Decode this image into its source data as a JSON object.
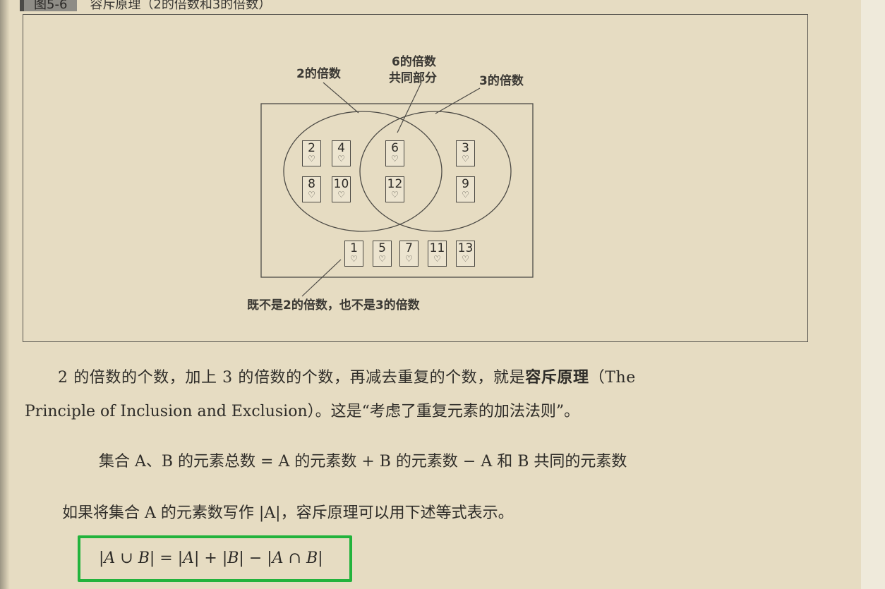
{
  "figure": {
    "caption_number": "图5-6",
    "caption_title": "容斥原理（2的倍数和3的倍数）",
    "label_multiples_2": "2的倍数",
    "label_multiples_6_line1": "6的倍数",
    "label_multiples_6_line2": "共同部分",
    "label_multiples_3": "3的倍数",
    "label_neither": "既不是2的倍数，也不是3的倍数",
    "suit_symbol": "♡",
    "cards_2_only": [
      "2",
      "4",
      "8",
      "10"
    ],
    "cards_both": [
      "6",
      "12"
    ],
    "cards_3_only": [
      "3",
      "9"
    ],
    "cards_neither": [
      "1",
      "5",
      "7",
      "11",
      "13"
    ]
  },
  "text": {
    "para1_part1": "2 的倍数的个数，加上 3 的倍数的个数，再减去重复的个数，就是",
    "para1_bold": "容斥原理",
    "para1_part2": "（The",
    "para1_line2": "Principle of Inclusion and Exclusion）。这是“考虑了重复元素的加法法则”。",
    "formula_words": "集合 A、B 的元素总数 = A 的元素数 + B 的元素数 − A 和 B 共同的元素数",
    "para2": "如果将集合 A 的元素数写作 |A|，容斥原理可以用下述等式表示。",
    "boxed_formula": "|A ∪ B| = |A| + |B| − |A ∩ B|"
  },
  "colors": {
    "highlight_box": "#22b33c",
    "page_background": "#e6dcc2"
  }
}
